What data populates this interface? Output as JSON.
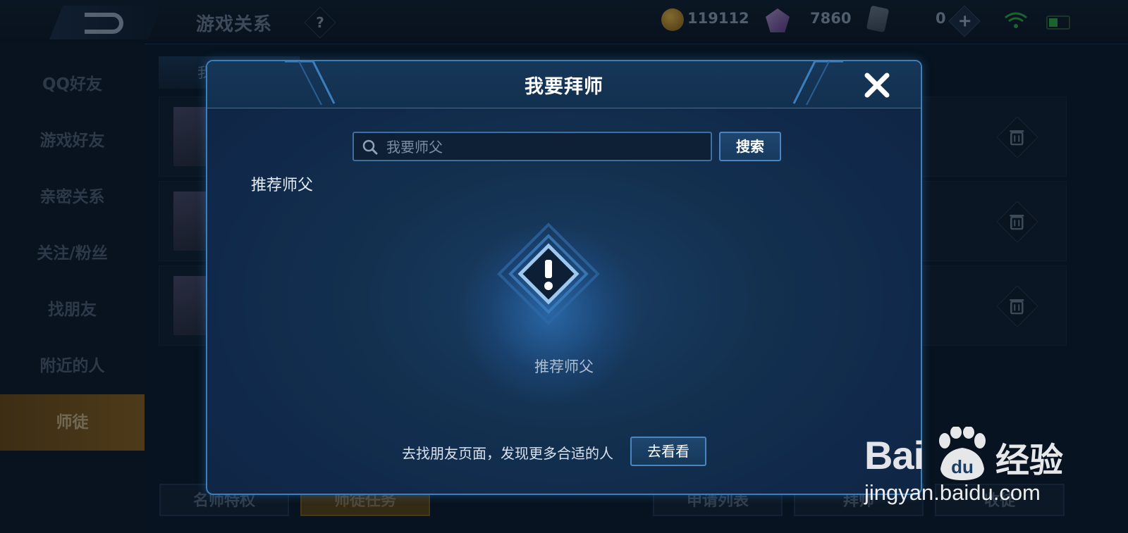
{
  "topbar": {
    "title": "游戏关系",
    "help": "?",
    "coins": "119112",
    "gems": "7860",
    "cards": "0",
    "plus": "+"
  },
  "sidebar": {
    "items": [
      {
        "label": "QQ好友"
      },
      {
        "label": "游戏好友"
      },
      {
        "label": "亲密关系"
      },
      {
        "label": "关注/粉丝"
      },
      {
        "label": "找朋友"
      },
      {
        "label": "附近的人"
      },
      {
        "label": "师徒"
      }
    ]
  },
  "background": {
    "tab": "我",
    "bottom_buttons": [
      "名师特权",
      "师徒任务",
      "申请列表",
      "拜师",
      "收徒"
    ]
  },
  "dialog": {
    "title": "我要拜师",
    "search_placeholder": "我要师父",
    "search_button": "搜索",
    "section_label": "推荐师父",
    "empty_text": "推荐师父",
    "hint": "去找朋友页面，发现更多合适的人",
    "go_button": "去看看"
  },
  "watermark": {
    "brand": "Bai",
    "brand_mark": "du",
    "product": "经验",
    "url": "jingyan.baidu.com"
  },
  "colors": {
    "accent": "#3c7fbd",
    "active_tab": "#8a6221",
    "dialog_bg": "#13304f"
  }
}
